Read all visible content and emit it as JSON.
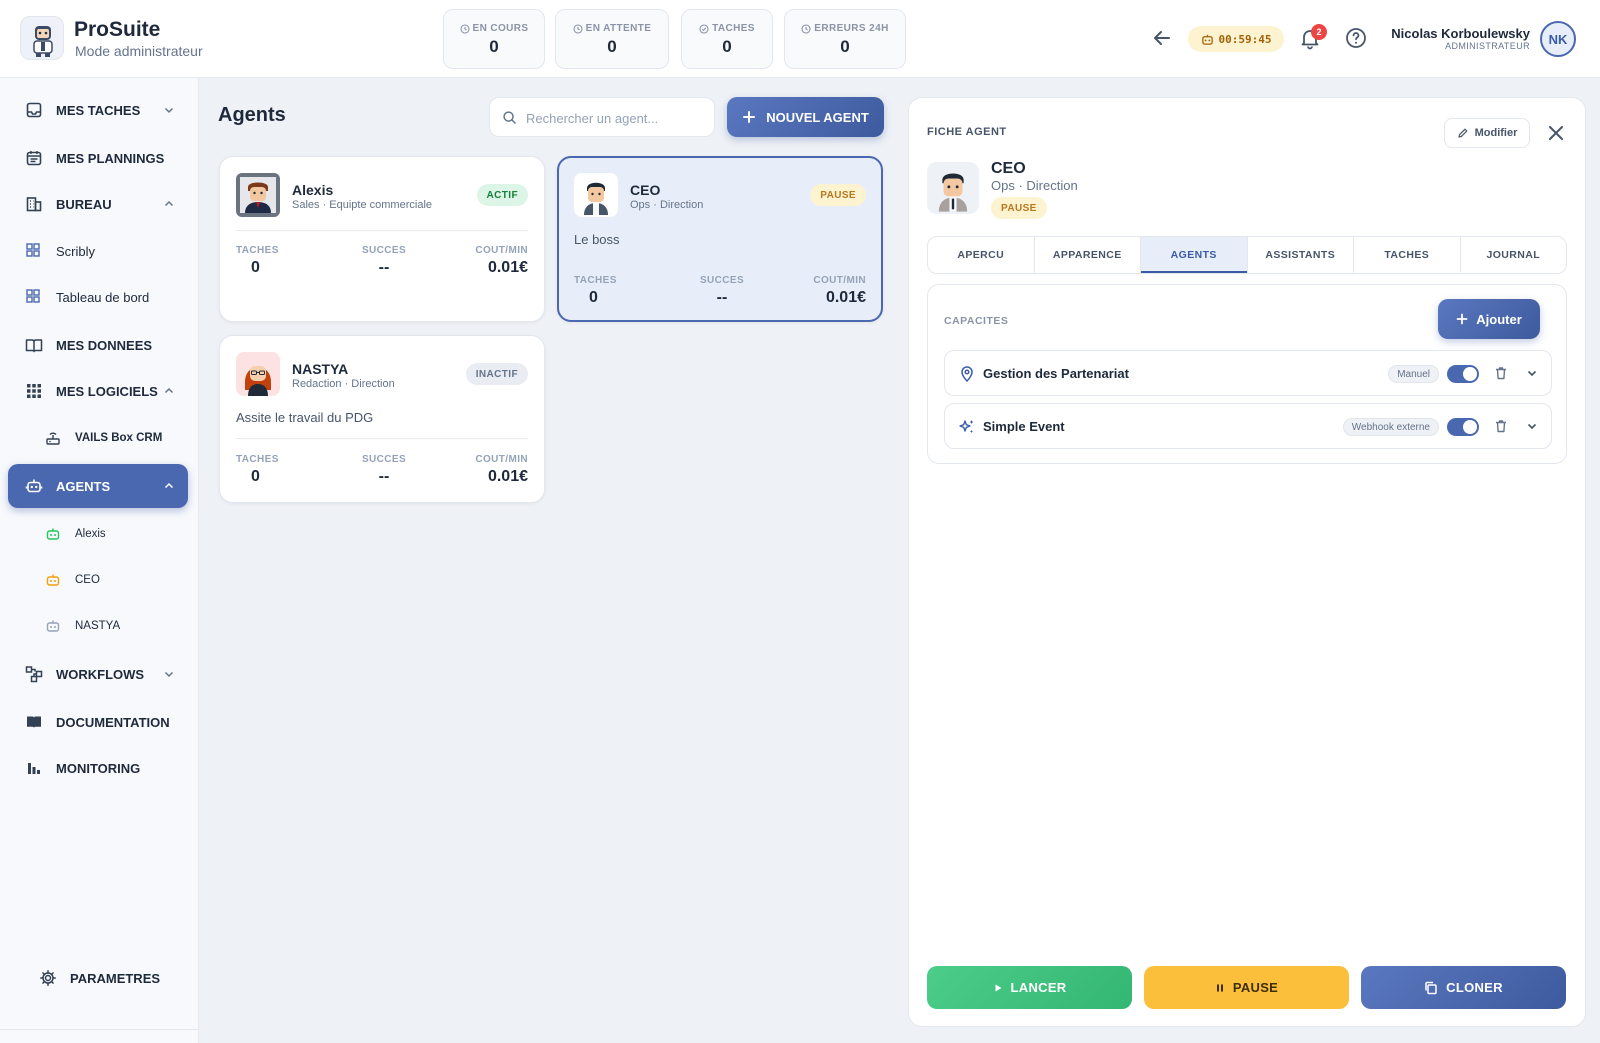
{
  "brand": {
    "title": "ProSuite",
    "subtitle": "Mode administrateur",
    "logo_icon": "robot-avatar-icon"
  },
  "stats": [
    {
      "label": "EN COURS",
      "value": "0",
      "icon": "clock-icon"
    },
    {
      "label": "EN ATTENTE",
      "value": "0",
      "icon": "clock-icon"
    },
    {
      "label": "TACHES",
      "value": "0",
      "icon": "check-circle-icon"
    },
    {
      "label": "ERREURS 24H",
      "value": "0",
      "icon": "clock-icon"
    }
  ],
  "header": {
    "timer": "00:59:45",
    "notifications": "2",
    "user_name": "Nicolas Korboulewsky",
    "user_role": "ADMINISTRATEUR",
    "user_initials": "NK"
  },
  "sidebar": {
    "items": [
      {
        "label": "MES TACHES",
        "icon": "inbox-icon"
      },
      {
        "label": "MES PLANNINGS",
        "icon": "calendar-icon"
      },
      {
        "label": "BUREAU",
        "icon": "building-icon"
      },
      {
        "label": "Scribly",
        "icon": "grid-icon"
      },
      {
        "label": "Tableau de bord",
        "icon": "grid-icon"
      },
      {
        "label": "MES DONNEES",
        "icon": "book-open-icon"
      },
      {
        "label": "MES LOGICIELS",
        "icon": "apps-icon"
      },
      {
        "label": "VAILS Box CRM",
        "icon": "router-icon"
      },
      {
        "label": "AGENTS",
        "icon": "robot-icon"
      },
      {
        "label": "Alexis",
        "icon": "robot-icon"
      },
      {
        "label": "CEO",
        "icon": "robot-icon"
      },
      {
        "label": "NASTYA",
        "icon": "robot-icon"
      },
      {
        "label": "WORKFLOWS",
        "icon": "workflow-icon"
      },
      {
        "label": "DOCUMENTATION",
        "icon": "book-icon"
      },
      {
        "label": "MONITORING",
        "icon": "bar-chart-icon"
      }
    ],
    "settings": {
      "label": "PARAMETRES",
      "icon": "gear-icon"
    }
  },
  "colors": {
    "accent": "#4a68b0",
    "status_active": "#15803d",
    "status_pause": "#b7791f",
    "status_inactive": "#64748b",
    "sub_icon_alexis": "#22c55e",
    "sub_icon_ceo": "#f59e0b",
    "sub_icon_nastya": "#94a3b8"
  },
  "agents_page": {
    "title": "Agents",
    "search_placeholder": "Rechercher un agent...",
    "new_agent_label": "NOUVEL AGENT",
    "metric_labels": {
      "tasks": "TACHES",
      "success": "SUCCES",
      "cost": "COUT/MIN"
    },
    "cards": [
      {
        "name": "Alexis",
        "role": "Sales · Equipte commerciale",
        "status": "ACTIF",
        "description": "",
        "tasks": "0",
        "success": "--",
        "cost": "0.01€"
      },
      {
        "name": "CEO",
        "role": "Ops · Direction",
        "status": "PAUSE",
        "description": "Le boss",
        "tasks": "0",
        "success": "--",
        "cost": "0.01€"
      },
      {
        "name": "NASTYA",
        "role": "Redaction · Direction",
        "status": "INACTIF",
        "description": "Assite le travail du PDG",
        "tasks": "0",
        "success": "--",
        "cost": "0.01€"
      }
    ]
  },
  "detail": {
    "heading": "FICHE AGENT",
    "edit_label": "Modifier",
    "name": "CEO",
    "role": "Ops · Direction",
    "status": "PAUSE",
    "tabs": [
      "APERCU",
      "APPARENCE",
      "AGENTS",
      "ASSISTANTS",
      "TACHES",
      "JOURNAL"
    ],
    "active_tab": "AGENTS",
    "capabilities_title": "CAPACITES",
    "add_label": "Ajouter",
    "capabilities": [
      {
        "name": "Gestion des Partenariat",
        "type": "Manuel",
        "icon": "location-pin-icon",
        "enabled": true
      },
      {
        "name": "Simple Event",
        "type": "Webhook externe",
        "icon": "sparkle-icon",
        "enabled": true
      }
    ],
    "actions": {
      "launch": "LANCER",
      "pause": "PAUSE",
      "clone": "CLONER"
    }
  }
}
